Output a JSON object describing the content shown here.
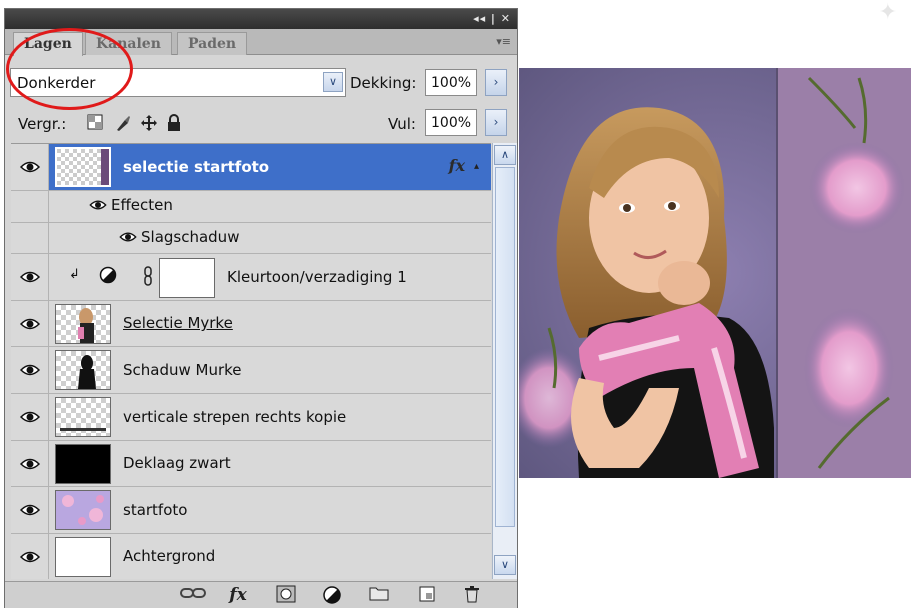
{
  "panel": {
    "title_buttons": "◂◂ | ✕",
    "tabs": [
      {
        "label": "Lagen",
        "active": true
      },
      {
        "label": "Kanalen",
        "active": false
      },
      {
        "label": "Paden",
        "active": false
      }
    ],
    "tab_menu_icon": "▾≡"
  },
  "blend": {
    "mode": "Donkerder",
    "arrow": "∨",
    "opacity_label": "Dekking:",
    "opacity_value": "100%",
    "stepper": "›"
  },
  "lock": {
    "label": "Vergr.:",
    "icons": [
      "transparency-lock-icon",
      "brush-lock-icon",
      "move-lock-icon",
      "padlock-icon"
    ],
    "fill_label": "Vul:",
    "fill_value": "100%",
    "stepper": "›"
  },
  "layers": [
    {
      "name": "selectie startfoto",
      "selected": true,
      "fx": "fx",
      "fx_arrow": "▴"
    },
    {
      "effects_label": "Effecten"
    },
    {
      "effect_name": "Slagschaduw"
    },
    {
      "name": "Kleurtoon/verzadiging 1",
      "adjustment": true
    },
    {
      "name": "Selectie Myrke",
      "underline": true
    },
    {
      "name": "Schaduw Murke"
    },
    {
      "name": "verticale strepen rechts kopie"
    },
    {
      "name": "Deklaag zwart"
    },
    {
      "name": "startfoto"
    },
    {
      "name": "Achtergrond"
    }
  ],
  "scroll": {
    "up": "∧",
    "down": "∨"
  },
  "bottom_icons": [
    "link-icon",
    "fx-icon",
    "mask-icon",
    "adjustment-icon",
    "folder-icon",
    "new-layer-icon",
    "trash-icon"
  ],
  "bottom_fx": "fx",
  "colors": {
    "selected_row": "#3e6fc9",
    "annotation": "#e01a1a",
    "photo_bg": "#7a6f96"
  }
}
